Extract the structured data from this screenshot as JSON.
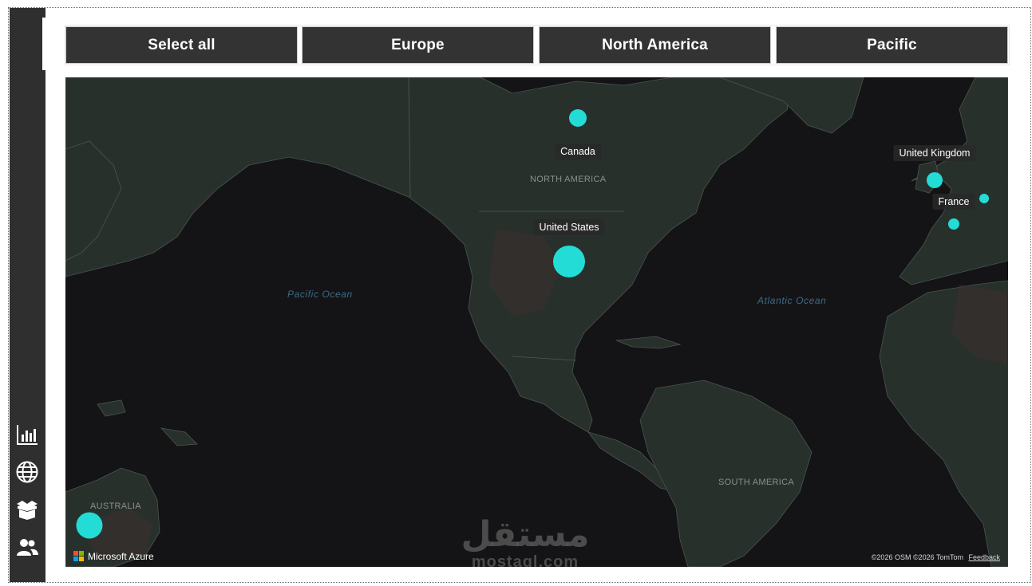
{
  "slicers": [
    {
      "label": "Select all"
    },
    {
      "label": "Europe"
    },
    {
      "label": "North America"
    },
    {
      "label": "Pacific"
    }
  ],
  "sidebar": {
    "items": [
      {
        "icon": "bar-chart-icon"
      },
      {
        "icon": "globe-icon"
      },
      {
        "icon": "box-icon"
      },
      {
        "icon": "users-icon"
      }
    ]
  },
  "map": {
    "countries": [
      {
        "name": "Canada",
        "size": "small"
      },
      {
        "name": "United States",
        "size": "large"
      },
      {
        "name": "United Kingdom",
        "size": "small"
      },
      {
        "name": "France",
        "size": "small"
      }
    ],
    "regions": [
      "NORTH AMERICA",
      "SOUTH AMERICA",
      "AUSTRALIA"
    ],
    "oceans": [
      "Pacific Ocean",
      "Atlantic Ocean"
    ],
    "logo_text": "Microsoft Azure",
    "attribution": "©2026 OSM  ©2026 TomTom",
    "feedback_link": "Feedback",
    "bubble_color": "#24dcd6"
  },
  "watermark": {
    "arabic": "مستقل",
    "latin": "mostaql.com"
  }
}
